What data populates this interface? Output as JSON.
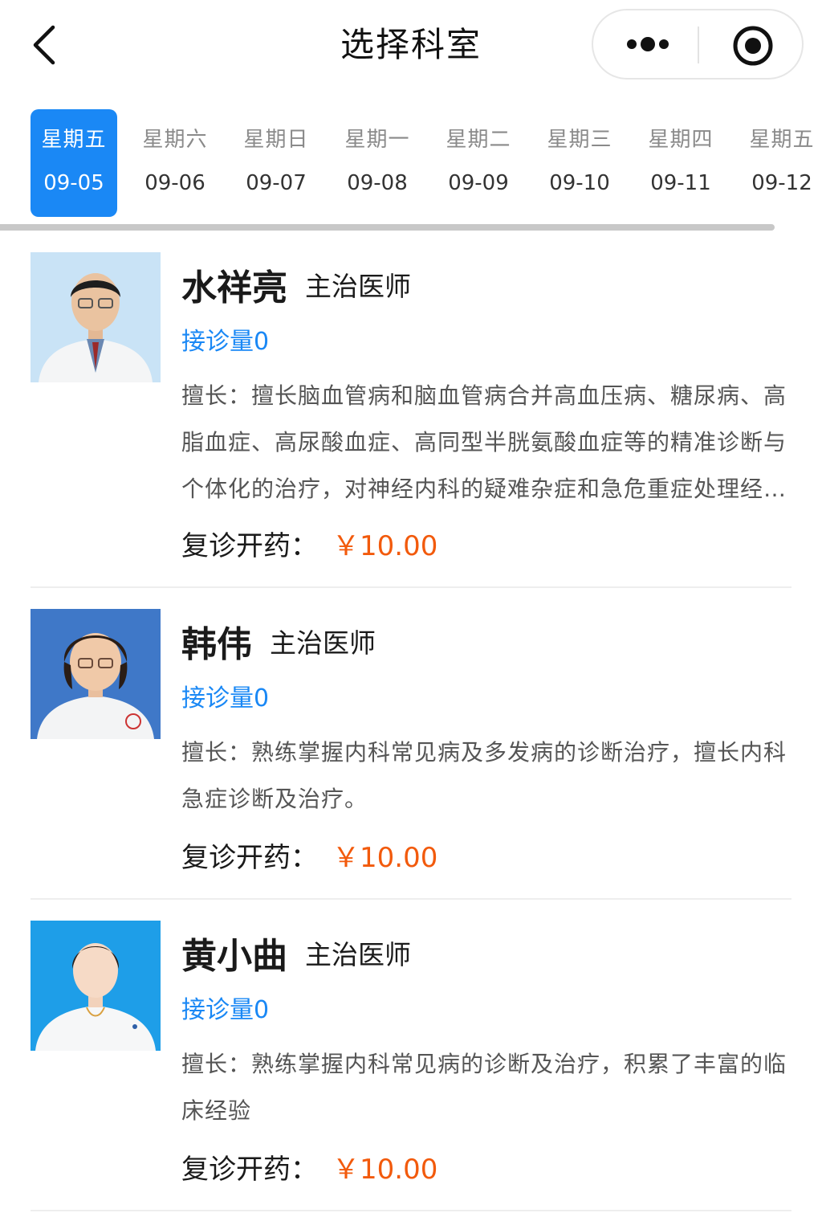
{
  "header": {
    "title": "选择科室"
  },
  "dates": [
    {
      "weekday": "星期五",
      "date": "09-05",
      "active": true
    },
    {
      "weekday": "星期六",
      "date": "09-06",
      "active": false
    },
    {
      "weekday": "星期日",
      "date": "09-07",
      "active": false
    },
    {
      "weekday": "星期一",
      "date": "09-08",
      "active": false
    },
    {
      "weekday": "星期二",
      "date": "09-09",
      "active": false
    },
    {
      "weekday": "星期三",
      "date": "09-10",
      "active": false
    },
    {
      "weekday": "星期四",
      "date": "09-11",
      "active": false
    },
    {
      "weekday": "星期五",
      "date": "09-12",
      "active": false
    }
  ],
  "doctors": [
    {
      "name": "水祥亮",
      "rank": "主治医师",
      "visits": "接诊量0",
      "skill": "擅长：擅长脑血管病和脑血管病合并高血压病、糖尿病、高脂血症、高尿酸血症、高同型半胱氨酸血症等的精准诊断与个体化的治疗，对神经内科的疑难杂症和急危重症处理经验丰富",
      "price_label": "复诊开药：",
      "price": "￥10.00"
    },
    {
      "name": "韩伟",
      "rank": "主治医师",
      "visits": "接诊量0",
      "skill": "擅长：熟练掌握内科常见病及多发病的诊断治疗，擅长内科急症诊断及治疗。",
      "price_label": "复诊开药：",
      "price": "￥10.00"
    },
    {
      "name": "黄小曲",
      "rank": "主治医师",
      "visits": "接诊量0",
      "skill": "擅长：熟练掌握内科常见病的诊断及治疗，积累了丰富的临床经验",
      "price_label": "复诊开药：",
      "price": "￥10.00"
    }
  ],
  "colors": {
    "accent": "#1a88f5",
    "price": "#f25a0c"
  },
  "icons": {
    "back": "chevron-left-icon",
    "more": "more-dots-icon",
    "close": "target-close-icon"
  }
}
